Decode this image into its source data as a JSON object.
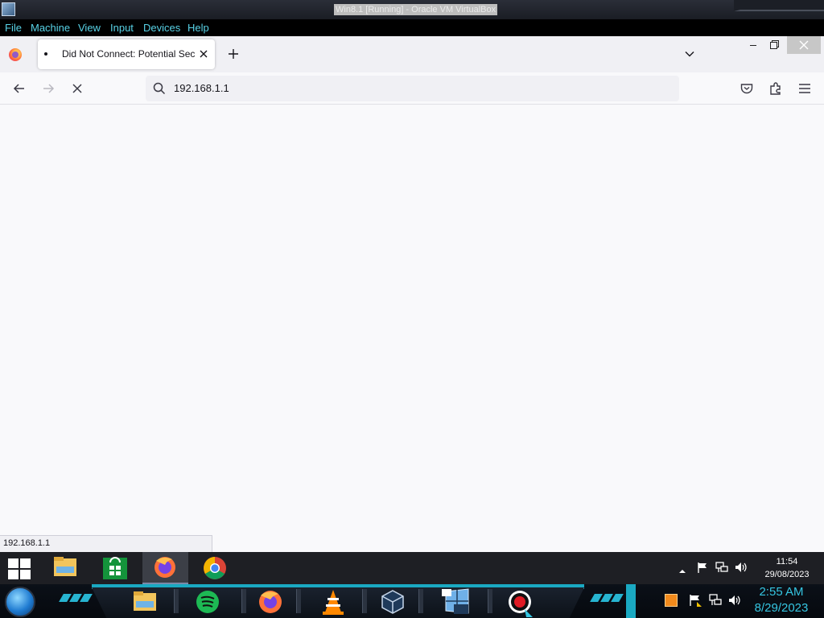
{
  "vbox": {
    "window_title": "Win8.1 [Running] - Oracle VM VirtualBox",
    "menu": [
      "File",
      "Machine",
      "View",
      "Input",
      "Devices",
      "Help"
    ]
  },
  "firefox": {
    "tab_title": "Did Not Connect: Potential Security Issue",
    "url": "192.168.1.1",
    "status_text": "192.168.1.1",
    "icons": {
      "tab_close": "close-icon",
      "new_tab": "plus-icon",
      "list_tabs": "chevron-down-icon",
      "back": "arrow-left-icon",
      "forward": "arrow-right-icon",
      "stop": "stop-icon",
      "search": "search-icon",
      "pocket": "pocket-icon",
      "extensions": "puzzle-icon",
      "menu": "hamburger-icon"
    }
  },
  "guest_taskbar": {
    "apps": [
      "file-explorer-icon",
      "store-icon",
      "firefox-icon",
      "chrome-icon"
    ],
    "clock_time": "11:54",
    "clock_date": "29/08/2023"
  },
  "host_taskbar": {
    "apps": [
      "file-explorer-icon",
      "spotify-icon",
      "firefox-icon",
      "vlc-icon",
      "virtualbox-icon",
      "win81-vm-icon",
      "recorder-icon"
    ],
    "clock_time": "2:55 AM",
    "clock_date": "8/29/2023"
  },
  "colors": {
    "accent_cyan": "#35c6e2",
    "menu_cyan": "#58d2e6",
    "firefox_bg": "#f9f9fb"
  }
}
